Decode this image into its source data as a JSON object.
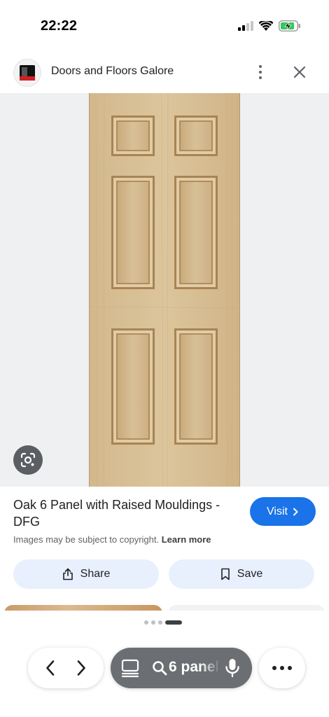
{
  "status_bar": {
    "time": "22:22",
    "icons": [
      "signal-icon",
      "wifi-icon",
      "battery-charging-icon"
    ]
  },
  "header": {
    "site_name": "Doors and Floors Galore",
    "favicon": "site-favicon",
    "more_icon": "more-vert-icon",
    "close_icon": "close-icon"
  },
  "image": {
    "subject": "oak-6-panel-door",
    "lens_icon": "google-lens-icon"
  },
  "result": {
    "title": "Oak 6 Panel with Raised Mouldings - DFG",
    "visit_label": "Visit",
    "copyright_text": "Images may be subject to copyright.",
    "learn_more": "Learn more"
  },
  "actions": {
    "share_label": "Share",
    "save_label": "Save"
  },
  "pagination": {
    "active_index": 3,
    "count": 4
  },
  "bottom_bar": {
    "search_text": "6 panel",
    "back_icon": "chevron-left-icon",
    "forward_icon": "chevron-right-icon",
    "tabs_icon": "tabs-icon",
    "search_icon": "search-icon",
    "mic_icon": "mic-icon",
    "menu_icon": "more-horiz-icon"
  },
  "colors": {
    "accent": "#1a73e8",
    "chip_bg": "#e8f0fe",
    "image_bg": "#eef0f2",
    "door_wood": "#d9c29a"
  }
}
